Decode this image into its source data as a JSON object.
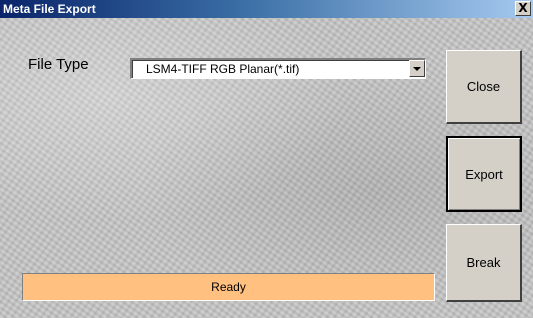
{
  "window": {
    "title": "Meta File Export",
    "close_glyph": "X",
    "titlebar_color": "#0a246a"
  },
  "form": {
    "file_type_label": "File Type",
    "file_type_value": "LSM4-TIFF RGB Planar(*.tif)"
  },
  "buttons": {
    "close_label": "Close",
    "export_label": "Export",
    "break_label": "Break"
  },
  "status": {
    "text": "Ready",
    "color": "#ffc080"
  },
  "icons": {
    "title_close": "close-icon",
    "combo_arrow": "chevron-down-icon"
  }
}
